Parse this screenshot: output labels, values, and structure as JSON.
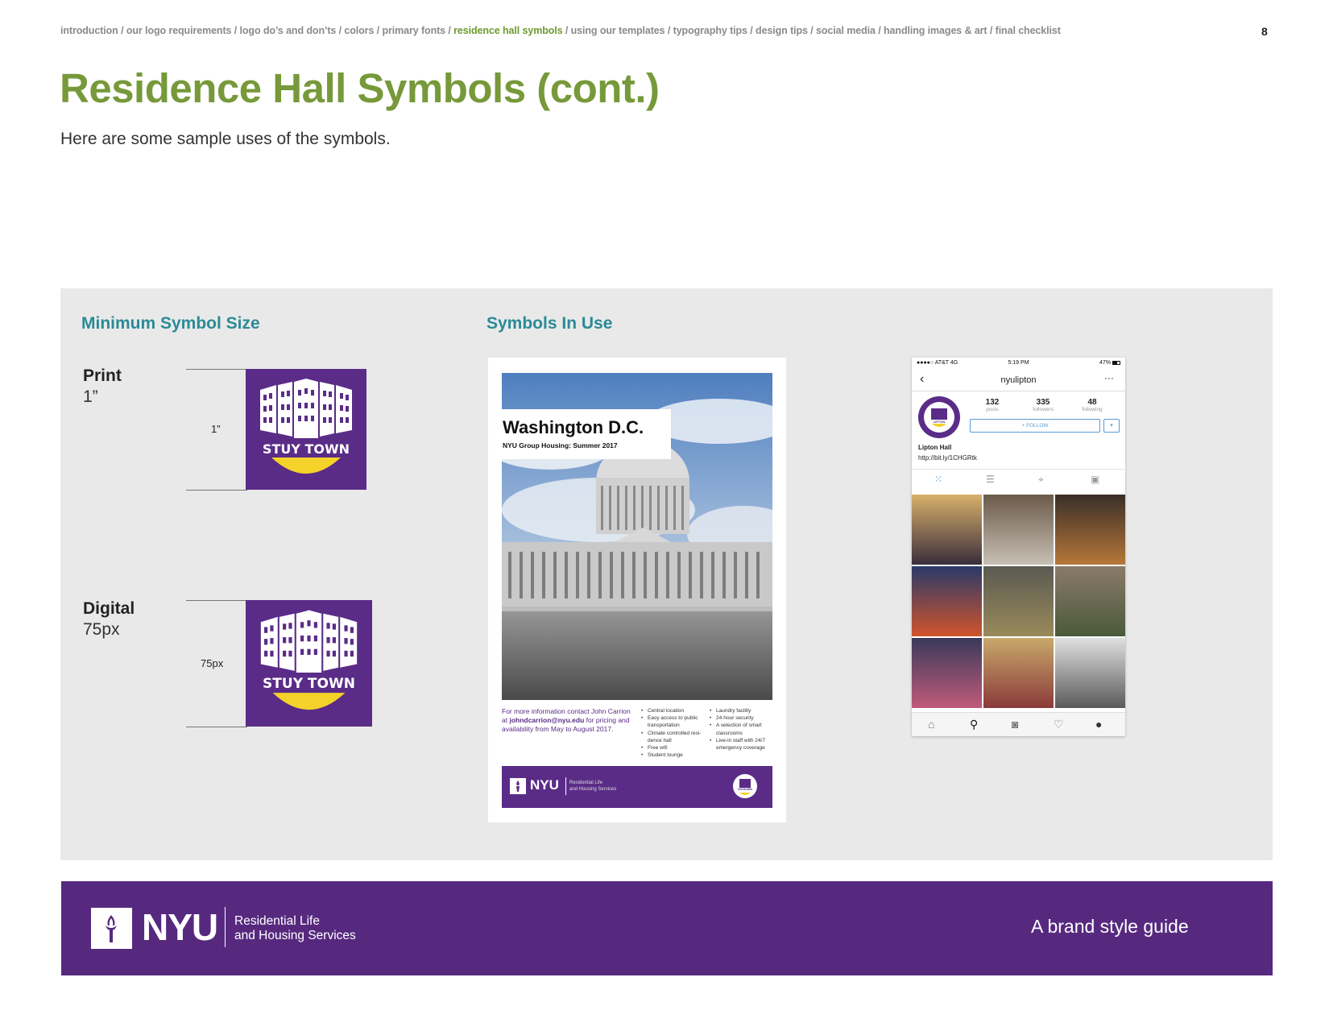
{
  "header": {
    "breadcrumb": [
      {
        "label": "introduction",
        "active": false
      },
      {
        "label": "our logo requirements",
        "active": false
      },
      {
        "label": "logo do’s and don’ts",
        "active": false
      },
      {
        "label": "colors",
        "active": false
      },
      {
        "label": "primary fonts",
        "active": false
      },
      {
        "label": "residence hall symbols",
        "active": true
      },
      {
        "label": "using our templates",
        "active": false
      },
      {
        "label": "typography tips",
        "active": false
      },
      {
        "label": "design tips",
        "active": false
      },
      {
        "label": "social media",
        "active": false
      },
      {
        "label": "handling images & art",
        "active": false
      },
      {
        "label": "final checklist",
        "active": false
      }
    ],
    "separator": " / ",
    "page_number": "8"
  },
  "main": {
    "title": "Residence Hall Symbols (cont.)",
    "subtitle": "Here are some sample uses of the symbols."
  },
  "minimum_size": {
    "heading": "Minimum Symbol Size",
    "print": {
      "label": "Print",
      "value": "1”",
      "measure": "1”",
      "symbol_text": "STUY TOWN"
    },
    "digital": {
      "label": "Digital",
      "value": "75px",
      "measure": "75px",
      "symbol_text": "STUY TOWN"
    }
  },
  "in_use": {
    "heading": "Symbols In Use",
    "poster": {
      "title": "Washington D.C.",
      "subtitle": "NYU Group Housing: Summer 2017",
      "contact_before": "For more information contact John Carrion at ",
      "contact_email": "johndcarrion@nyu.edu",
      "contact_after": " for pricing and availability from May to August 2017.",
      "list_left": [
        "Central location",
        "Easy access to public transportation",
        "Climate controlled resi-dence hall",
        "Free wifi",
        "Student lounge"
      ],
      "list_right": [
        "Laundry facility",
        "24-hour security",
        "A selection of smart classrooms",
        "Live-in staff with 24/7 emergency coverage"
      ],
      "band_brand": "NYU",
      "band_dept_line1": "Residential Life",
      "band_dept_line2": "and Housing Services",
      "badge_text": "GODDARD"
    },
    "phone": {
      "carrier": "●●●●○ AT&T  4G",
      "time": "5:19 PM",
      "battery_text": "47%",
      "username": "nyulipton",
      "avatar_text": "LIPTON",
      "stats": [
        {
          "value": "132",
          "label": "posts"
        },
        {
          "value": "335",
          "label": "followers"
        },
        {
          "value": "48",
          "label": "following"
        }
      ],
      "follow_label": "+ FOLLOW",
      "bio_name": "Lipton Hall",
      "bio_link": "http://bit.ly/1CHGRtk"
    }
  },
  "footer": {
    "brand": "NYU",
    "dept_line1": "Residential Life",
    "dept_line2": "and Housing Services",
    "tagline": "A brand style guide"
  },
  "colors": {
    "brand_purple": "#5a2c87",
    "title_green": "#77993a",
    "heading_teal": "#2b8a97",
    "symbol_yellow": "#f4d22a"
  }
}
